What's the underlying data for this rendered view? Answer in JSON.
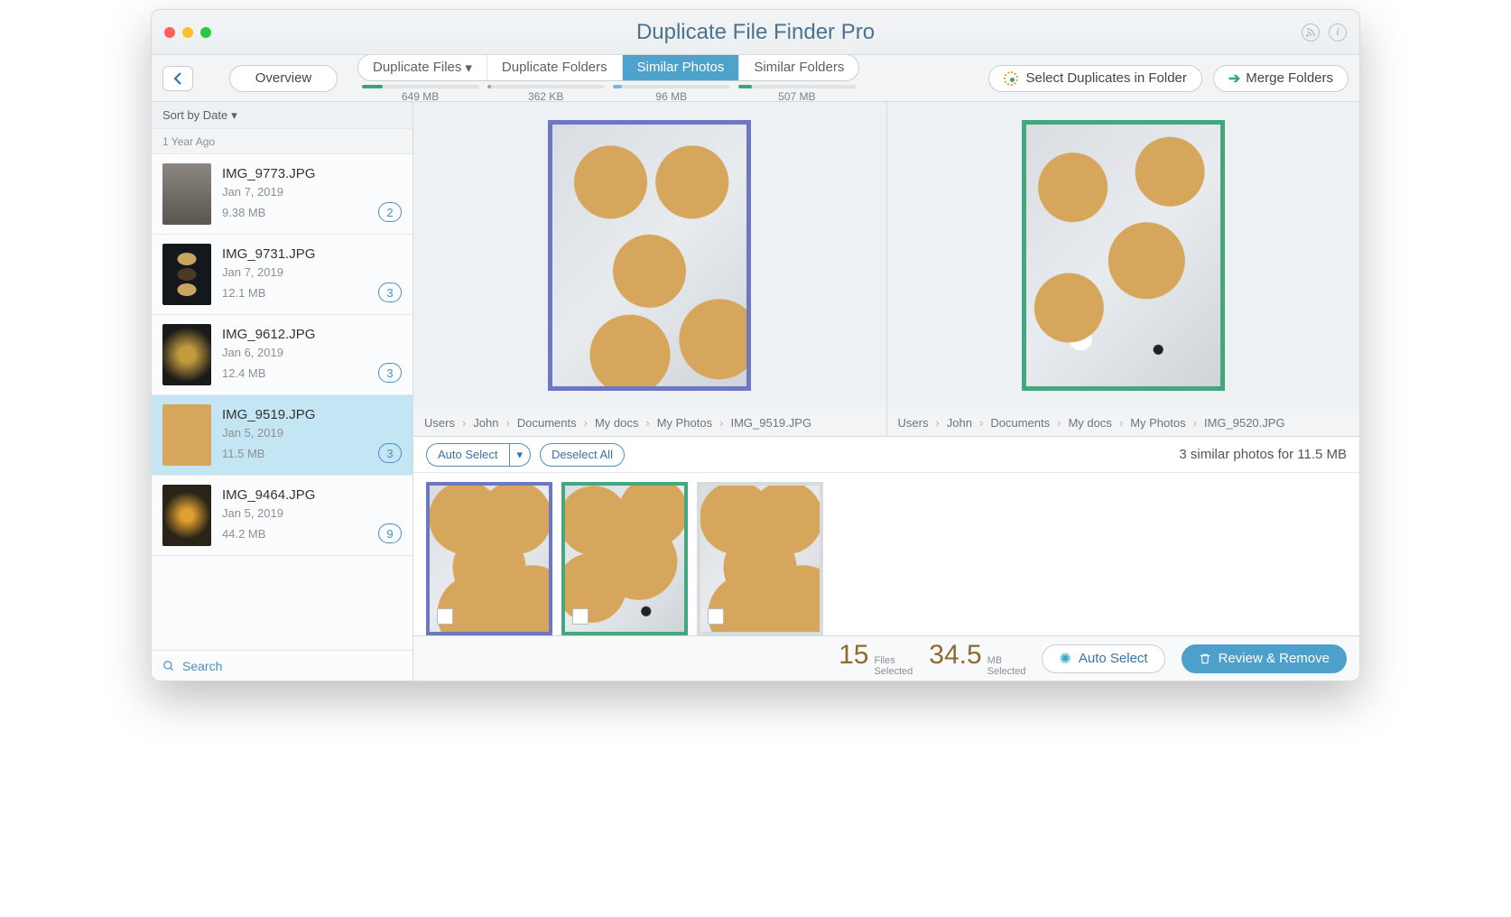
{
  "app_title": "Duplicate File Finder Pro",
  "toolbar": {
    "overview": "Overview",
    "tabs": [
      {
        "label": "Duplicate Files",
        "size": "649 MB",
        "has_dropdown": true,
        "fill": 18,
        "color": "#3aa47a"
      },
      {
        "label": "Duplicate Folders",
        "size": "362 KB",
        "fill": 3,
        "color": "#9aa0a6"
      },
      {
        "label": "Similar Photos",
        "size": "96 MB",
        "active": true,
        "fill": 8,
        "color": "#ffffff"
      },
      {
        "label": "Similar Folders",
        "size": "507 MB",
        "fill": 12,
        "color": "#3aa47a"
      }
    ],
    "select_in_folder": "Select Duplicates in Folder",
    "merge_folders": "Merge Folders"
  },
  "sidebar": {
    "sort_label": "Sort by Date",
    "section": "1 Year Ago",
    "items": [
      {
        "name": "IMG_9773.JPG",
        "date": "Jan 7, 2019",
        "size": "9.38 MB",
        "count": "2",
        "thumb": "portrait-thumb"
      },
      {
        "name": "IMG_9731.JPG",
        "date": "Jan 7, 2019",
        "size": "12.1 MB",
        "count": "3",
        "thumb": "seeds-thumb"
      },
      {
        "name": "IMG_9612.JPG",
        "date": "Jan 6, 2019",
        "size": "12.4 MB",
        "count": "3",
        "thumb": "gold-thumb"
      },
      {
        "name": "IMG_9519.JPG",
        "date": "Jan 5, 2019",
        "size": "11.5 MB",
        "count": "3",
        "thumb": "cookies",
        "selected": true
      },
      {
        "name": "IMG_9464.JPG",
        "date": "Jan 5, 2019",
        "size": "44.2 MB",
        "count": "9",
        "thumb": "flower-thumb"
      }
    ],
    "search": "Search"
  },
  "compare": {
    "left": {
      "border": "#6c79c1",
      "path": [
        "Users",
        "John",
        "Documents",
        "My docs",
        "My Photos",
        "IMG_9519.JPG"
      ],
      "img": "cookies"
    },
    "right": {
      "border": "#44a77d",
      "path": [
        "Users",
        "John",
        "Documents",
        "My docs",
        "My Photos",
        "IMG_9520.JPG"
      ],
      "img": "cookies cookies2"
    }
  },
  "strip": {
    "auto_select": "Auto Select",
    "deselect": "Deselect All",
    "summary": "3 similar photos for 11.5 MB",
    "thumbs": [
      {
        "border": "#6c79c1",
        "img": "cookies"
      },
      {
        "border": "#44a77d",
        "img": "cookies cookies2"
      },
      {
        "border": "#d8dbde",
        "img": "cookies"
      }
    ]
  },
  "footer": {
    "files_num": "15",
    "files_l1": "Files",
    "files_l2": "Selected",
    "mb_num": "34.5",
    "mb_l1": "MB",
    "mb_l2": "Selected",
    "auto": "Auto Select",
    "review": "Review & Remove"
  }
}
